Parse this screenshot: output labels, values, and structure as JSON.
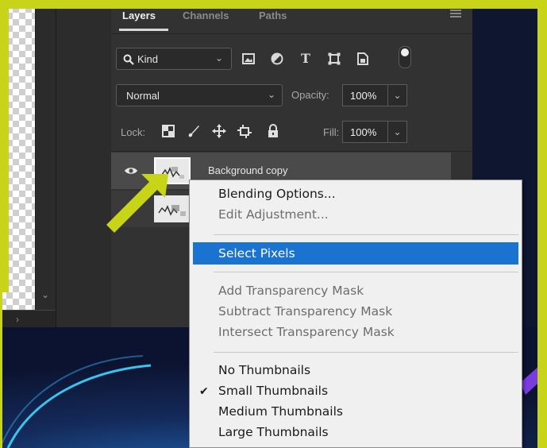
{
  "panel": {
    "tabs": [
      "Layers",
      "Channels",
      "Paths"
    ],
    "kind_filter": {
      "label": "Kind"
    },
    "blend_mode": "Normal",
    "opacity_label": "Opacity:",
    "opacity_value": "100%",
    "lock_label": "Lock:",
    "fill_label": "Fill:",
    "fill_value": "100%",
    "filter_icons": [
      "image-filter-icon",
      "adjustment-filter-icon",
      "type-filter-icon",
      "shape-filter-icon",
      "smart-object-filter-icon",
      "filter-toggle-icon"
    ],
    "lock_icons": [
      "lock-transparent-pixels-icon",
      "lock-image-pixels-icon",
      "lock-position-icon",
      "lock-artboard-icon",
      "lock-all-icon"
    ]
  },
  "layers": [
    {
      "name": "Background copy",
      "visible": true,
      "selected": true
    },
    {
      "name": "",
      "visible": false,
      "selected": false
    }
  ],
  "context_menu": {
    "items": [
      {
        "label": "Blending Options...",
        "enabled": true
      },
      {
        "label": "Edit Adjustment...",
        "enabled": false
      },
      {
        "label": "Select Pixels",
        "enabled": true,
        "highlighted": true
      },
      {
        "label": "Add Transparency Mask",
        "enabled": false
      },
      {
        "label": "Subtract Transparency Mask",
        "enabled": false
      },
      {
        "label": "Intersect Transparency Mask",
        "enabled": false
      },
      {
        "label": "No Thumbnails",
        "enabled": true
      },
      {
        "label": "Small Thumbnails",
        "enabled": true,
        "checked": true
      },
      {
        "label": "Medium Thumbnails",
        "enabled": true
      },
      {
        "label": "Large Thumbnails",
        "enabled": true
      }
    ]
  },
  "colors": {
    "highlight": "#1a73d1",
    "annotation_frame": "#c8d417",
    "panel_bg": "#323232"
  }
}
